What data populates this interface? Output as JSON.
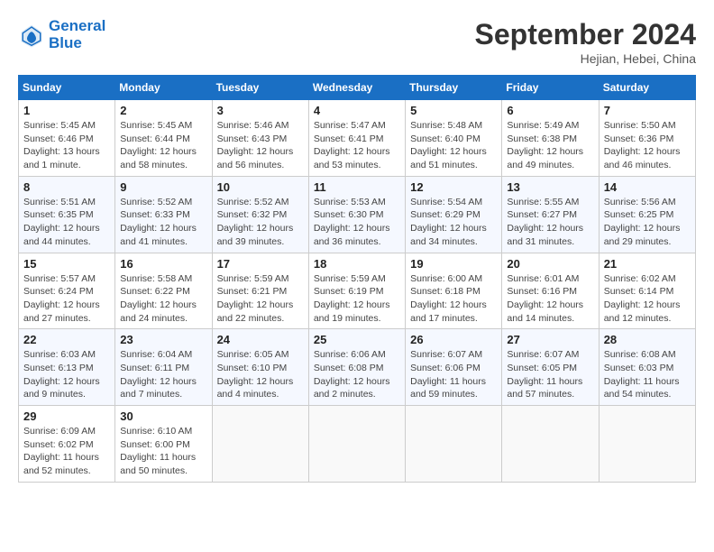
{
  "header": {
    "logo_line1": "General",
    "logo_line2": "Blue",
    "month_title": "September 2024",
    "subtitle": "Hejian, Hebei, China"
  },
  "weekdays": [
    "Sunday",
    "Monday",
    "Tuesday",
    "Wednesday",
    "Thursday",
    "Friday",
    "Saturday"
  ],
  "weeks": [
    [
      {
        "day": "1",
        "info": "Sunrise: 5:45 AM\nSunset: 6:46 PM\nDaylight: 13 hours\nand 1 minute."
      },
      {
        "day": "2",
        "info": "Sunrise: 5:45 AM\nSunset: 6:44 PM\nDaylight: 12 hours\nand 58 minutes."
      },
      {
        "day": "3",
        "info": "Sunrise: 5:46 AM\nSunset: 6:43 PM\nDaylight: 12 hours\nand 56 minutes."
      },
      {
        "day": "4",
        "info": "Sunrise: 5:47 AM\nSunset: 6:41 PM\nDaylight: 12 hours\nand 53 minutes."
      },
      {
        "day": "5",
        "info": "Sunrise: 5:48 AM\nSunset: 6:40 PM\nDaylight: 12 hours\nand 51 minutes."
      },
      {
        "day": "6",
        "info": "Sunrise: 5:49 AM\nSunset: 6:38 PM\nDaylight: 12 hours\nand 49 minutes."
      },
      {
        "day": "7",
        "info": "Sunrise: 5:50 AM\nSunset: 6:36 PM\nDaylight: 12 hours\nand 46 minutes."
      }
    ],
    [
      {
        "day": "8",
        "info": "Sunrise: 5:51 AM\nSunset: 6:35 PM\nDaylight: 12 hours\nand 44 minutes."
      },
      {
        "day": "9",
        "info": "Sunrise: 5:52 AM\nSunset: 6:33 PM\nDaylight: 12 hours\nand 41 minutes."
      },
      {
        "day": "10",
        "info": "Sunrise: 5:52 AM\nSunset: 6:32 PM\nDaylight: 12 hours\nand 39 minutes."
      },
      {
        "day": "11",
        "info": "Sunrise: 5:53 AM\nSunset: 6:30 PM\nDaylight: 12 hours\nand 36 minutes."
      },
      {
        "day": "12",
        "info": "Sunrise: 5:54 AM\nSunset: 6:29 PM\nDaylight: 12 hours\nand 34 minutes."
      },
      {
        "day": "13",
        "info": "Sunrise: 5:55 AM\nSunset: 6:27 PM\nDaylight: 12 hours\nand 31 minutes."
      },
      {
        "day": "14",
        "info": "Sunrise: 5:56 AM\nSunset: 6:25 PM\nDaylight: 12 hours\nand 29 minutes."
      }
    ],
    [
      {
        "day": "15",
        "info": "Sunrise: 5:57 AM\nSunset: 6:24 PM\nDaylight: 12 hours\nand 27 minutes."
      },
      {
        "day": "16",
        "info": "Sunrise: 5:58 AM\nSunset: 6:22 PM\nDaylight: 12 hours\nand 24 minutes."
      },
      {
        "day": "17",
        "info": "Sunrise: 5:59 AM\nSunset: 6:21 PM\nDaylight: 12 hours\nand 22 minutes."
      },
      {
        "day": "18",
        "info": "Sunrise: 5:59 AM\nSunset: 6:19 PM\nDaylight: 12 hours\nand 19 minutes."
      },
      {
        "day": "19",
        "info": "Sunrise: 6:00 AM\nSunset: 6:18 PM\nDaylight: 12 hours\nand 17 minutes."
      },
      {
        "day": "20",
        "info": "Sunrise: 6:01 AM\nSunset: 6:16 PM\nDaylight: 12 hours\nand 14 minutes."
      },
      {
        "day": "21",
        "info": "Sunrise: 6:02 AM\nSunset: 6:14 PM\nDaylight: 12 hours\nand 12 minutes."
      }
    ],
    [
      {
        "day": "22",
        "info": "Sunrise: 6:03 AM\nSunset: 6:13 PM\nDaylight: 12 hours\nand 9 minutes."
      },
      {
        "day": "23",
        "info": "Sunrise: 6:04 AM\nSunset: 6:11 PM\nDaylight: 12 hours\nand 7 minutes."
      },
      {
        "day": "24",
        "info": "Sunrise: 6:05 AM\nSunset: 6:10 PM\nDaylight: 12 hours\nand 4 minutes."
      },
      {
        "day": "25",
        "info": "Sunrise: 6:06 AM\nSunset: 6:08 PM\nDaylight: 12 hours\nand 2 minutes."
      },
      {
        "day": "26",
        "info": "Sunrise: 6:07 AM\nSunset: 6:06 PM\nDaylight: 11 hours\nand 59 minutes."
      },
      {
        "day": "27",
        "info": "Sunrise: 6:07 AM\nSunset: 6:05 PM\nDaylight: 11 hours\nand 57 minutes."
      },
      {
        "day": "28",
        "info": "Sunrise: 6:08 AM\nSunset: 6:03 PM\nDaylight: 11 hours\nand 54 minutes."
      }
    ],
    [
      {
        "day": "29",
        "info": "Sunrise: 6:09 AM\nSunset: 6:02 PM\nDaylight: 11 hours\nand 52 minutes."
      },
      {
        "day": "30",
        "info": "Sunrise: 6:10 AM\nSunset: 6:00 PM\nDaylight: 11 hours\nand 50 minutes."
      },
      {
        "day": "",
        "info": ""
      },
      {
        "day": "",
        "info": ""
      },
      {
        "day": "",
        "info": ""
      },
      {
        "day": "",
        "info": ""
      },
      {
        "day": "",
        "info": ""
      }
    ]
  ]
}
